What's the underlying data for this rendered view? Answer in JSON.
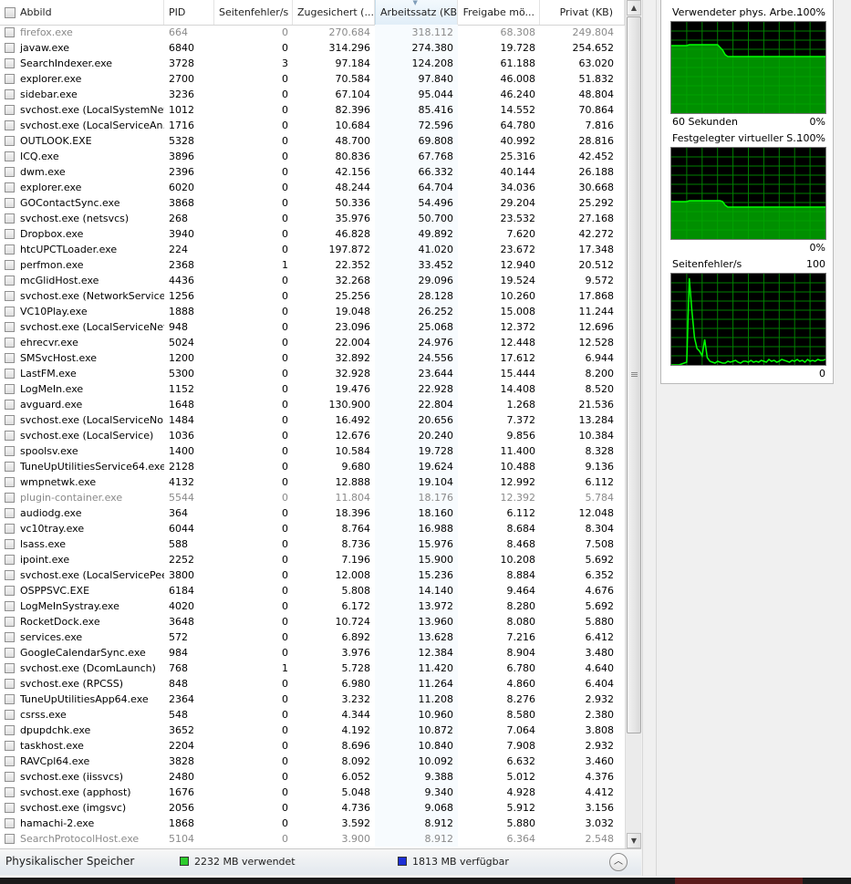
{
  "columns": {
    "name": "Abbild",
    "pid": "PID",
    "page_faults": "Seitenfehler/s",
    "commit": "Zugesichert (...",
    "working_set": "Arbeitssatz (KB)",
    "shareable": "Freigabe mö...",
    "private": "Privat (KB)"
  },
  "processes": [
    {
      "name": "firefox.exe",
      "pid": "664",
      "pf": "0",
      "commit": "270.684",
      "ws": "318.112",
      "share": "68.308",
      "priv": "249.804",
      "dim": true
    },
    {
      "name": "javaw.exe",
      "pid": "6840",
      "pf": "0",
      "commit": "314.296",
      "ws": "274.380",
      "share": "19.728",
      "priv": "254.652"
    },
    {
      "name": "SearchIndexer.exe",
      "pid": "3728",
      "pf": "3",
      "commit": "97.184",
      "ws": "124.208",
      "share": "61.188",
      "priv": "63.020"
    },
    {
      "name": "explorer.exe",
      "pid": "2700",
      "pf": "0",
      "commit": "70.584",
      "ws": "97.840",
      "share": "46.008",
      "priv": "51.832"
    },
    {
      "name": "sidebar.exe",
      "pid": "3236",
      "pf": "0",
      "commit": "67.104",
      "ws": "95.044",
      "share": "46.240",
      "priv": "48.804"
    },
    {
      "name": "svchost.exe (LocalSystemNet...",
      "pid": "1012",
      "pf": "0",
      "commit": "82.396",
      "ws": "85.416",
      "share": "14.552",
      "priv": "70.864"
    },
    {
      "name": "svchost.exe (LocalServiceAn...",
      "pid": "1716",
      "pf": "0",
      "commit": "10.684",
      "ws": "72.596",
      "share": "64.780",
      "priv": "7.816"
    },
    {
      "name": "OUTLOOK.EXE",
      "pid": "5328",
      "pf": "0",
      "commit": "48.700",
      "ws": "69.808",
      "share": "40.992",
      "priv": "28.816"
    },
    {
      "name": "ICQ.exe",
      "pid": "3896",
      "pf": "0",
      "commit": "80.836",
      "ws": "67.768",
      "share": "25.316",
      "priv": "42.452"
    },
    {
      "name": "dwm.exe",
      "pid": "2396",
      "pf": "0",
      "commit": "42.156",
      "ws": "66.332",
      "share": "40.144",
      "priv": "26.188"
    },
    {
      "name": "explorer.exe",
      "pid": "6020",
      "pf": "0",
      "commit": "48.244",
      "ws": "64.704",
      "share": "34.036",
      "priv": "30.668"
    },
    {
      "name": "GOContactSync.exe",
      "pid": "3868",
      "pf": "0",
      "commit": "50.336",
      "ws": "54.496",
      "share": "29.204",
      "priv": "25.292"
    },
    {
      "name": "svchost.exe (netsvcs)",
      "pid": "268",
      "pf": "0",
      "commit": "35.976",
      "ws": "50.700",
      "share": "23.532",
      "priv": "27.168"
    },
    {
      "name": "Dropbox.exe",
      "pid": "3940",
      "pf": "0",
      "commit": "46.828",
      "ws": "49.892",
      "share": "7.620",
      "priv": "42.272"
    },
    {
      "name": "htcUPCTLoader.exe",
      "pid": "224",
      "pf": "0",
      "commit": "197.872",
      "ws": "41.020",
      "share": "23.672",
      "priv": "17.348"
    },
    {
      "name": "perfmon.exe",
      "pid": "2368",
      "pf": "1",
      "commit": "22.352",
      "ws": "33.452",
      "share": "12.940",
      "priv": "20.512"
    },
    {
      "name": "mcGlidHost.exe",
      "pid": "4436",
      "pf": "0",
      "commit": "32.268",
      "ws": "29.096",
      "share": "19.524",
      "priv": "9.572"
    },
    {
      "name": "svchost.exe (NetworkService)",
      "pid": "1256",
      "pf": "0",
      "commit": "25.256",
      "ws": "28.128",
      "share": "10.260",
      "priv": "17.868"
    },
    {
      "name": "VC10Play.exe",
      "pid": "1888",
      "pf": "0",
      "commit": "19.048",
      "ws": "26.252",
      "share": "15.008",
      "priv": "11.244"
    },
    {
      "name": "svchost.exe (LocalServiceNet...",
      "pid": "948",
      "pf": "0",
      "commit": "23.096",
      "ws": "25.068",
      "share": "12.372",
      "priv": "12.696"
    },
    {
      "name": "ehrecvr.exe",
      "pid": "5024",
      "pf": "0",
      "commit": "22.004",
      "ws": "24.976",
      "share": "12.448",
      "priv": "12.528"
    },
    {
      "name": "SMSvcHost.exe",
      "pid": "1200",
      "pf": "0",
      "commit": "32.892",
      "ws": "24.556",
      "share": "17.612",
      "priv": "6.944"
    },
    {
      "name": "LastFM.exe",
      "pid": "5300",
      "pf": "0",
      "commit": "32.928",
      "ws": "23.644",
      "share": "15.444",
      "priv": "8.200"
    },
    {
      "name": "LogMeIn.exe",
      "pid": "1152",
      "pf": "0",
      "commit": "19.476",
      "ws": "22.928",
      "share": "14.408",
      "priv": "8.520"
    },
    {
      "name": "avguard.exe",
      "pid": "1648",
      "pf": "0",
      "commit": "130.900",
      "ws": "22.804",
      "share": "1.268",
      "priv": "21.536"
    },
    {
      "name": "svchost.exe (LocalServiceNo...",
      "pid": "1484",
      "pf": "0",
      "commit": "16.492",
      "ws": "20.656",
      "share": "7.372",
      "priv": "13.284"
    },
    {
      "name": "svchost.exe (LocalService)",
      "pid": "1036",
      "pf": "0",
      "commit": "12.676",
      "ws": "20.240",
      "share": "9.856",
      "priv": "10.384"
    },
    {
      "name": "spoolsv.exe",
      "pid": "1400",
      "pf": "0",
      "commit": "10.584",
      "ws": "19.728",
      "share": "11.400",
      "priv": "8.328"
    },
    {
      "name": "TuneUpUtilitiesService64.exe",
      "pid": "2128",
      "pf": "0",
      "commit": "9.680",
      "ws": "19.624",
      "share": "10.488",
      "priv": "9.136"
    },
    {
      "name": "wmpnetwk.exe",
      "pid": "4132",
      "pf": "0",
      "commit": "12.888",
      "ws": "19.104",
      "share": "12.992",
      "priv": "6.112"
    },
    {
      "name": "plugin-container.exe",
      "pid": "5544",
      "pf": "0",
      "commit": "11.804",
      "ws": "18.176",
      "share": "12.392",
      "priv": "5.784",
      "dim": true
    },
    {
      "name": "audiodg.exe",
      "pid": "364",
      "pf": "0",
      "commit": "18.396",
      "ws": "18.160",
      "share": "6.112",
      "priv": "12.048"
    },
    {
      "name": "vc10tray.exe",
      "pid": "6044",
      "pf": "0",
      "commit": "8.764",
      "ws": "16.988",
      "share": "8.684",
      "priv": "8.304"
    },
    {
      "name": "lsass.exe",
      "pid": "588",
      "pf": "0",
      "commit": "8.736",
      "ws": "15.976",
      "share": "8.468",
      "priv": "7.508"
    },
    {
      "name": "ipoint.exe",
      "pid": "2252",
      "pf": "0",
      "commit": "7.196",
      "ws": "15.900",
      "share": "10.208",
      "priv": "5.692"
    },
    {
      "name": "svchost.exe (LocalServicePee...",
      "pid": "3800",
      "pf": "0",
      "commit": "12.008",
      "ws": "15.236",
      "share": "8.884",
      "priv": "6.352"
    },
    {
      "name": "OSPPSVC.EXE",
      "pid": "6184",
      "pf": "0",
      "commit": "5.808",
      "ws": "14.140",
      "share": "9.464",
      "priv": "4.676"
    },
    {
      "name": "LogMeInSystray.exe",
      "pid": "4020",
      "pf": "0",
      "commit": "6.172",
      "ws": "13.972",
      "share": "8.280",
      "priv": "5.692"
    },
    {
      "name": "RocketDock.exe",
      "pid": "3648",
      "pf": "0",
      "commit": "10.724",
      "ws": "13.960",
      "share": "8.080",
      "priv": "5.880"
    },
    {
      "name": "services.exe",
      "pid": "572",
      "pf": "0",
      "commit": "6.892",
      "ws": "13.628",
      "share": "7.216",
      "priv": "6.412"
    },
    {
      "name": "GoogleCalendarSync.exe",
      "pid": "984",
      "pf": "0",
      "commit": "3.976",
      "ws": "12.384",
      "share": "8.904",
      "priv": "3.480"
    },
    {
      "name": "svchost.exe (DcomLaunch)",
      "pid": "768",
      "pf": "1",
      "commit": "5.728",
      "ws": "11.420",
      "share": "6.780",
      "priv": "4.640"
    },
    {
      "name": "svchost.exe (RPCSS)",
      "pid": "848",
      "pf": "0",
      "commit": "6.980",
      "ws": "11.264",
      "share": "4.860",
      "priv": "6.404"
    },
    {
      "name": "TuneUpUtilitiesApp64.exe",
      "pid": "2364",
      "pf": "0",
      "commit": "3.232",
      "ws": "11.208",
      "share": "8.276",
      "priv": "2.932"
    },
    {
      "name": "csrss.exe",
      "pid": "548",
      "pf": "0",
      "commit": "4.344",
      "ws": "10.960",
      "share": "8.580",
      "priv": "2.380"
    },
    {
      "name": "dpupdchk.exe",
      "pid": "3652",
      "pf": "0",
      "commit": "4.192",
      "ws": "10.872",
      "share": "7.064",
      "priv": "3.808"
    },
    {
      "name": "taskhost.exe",
      "pid": "2204",
      "pf": "0",
      "commit": "8.696",
      "ws": "10.840",
      "share": "7.908",
      "priv": "2.932"
    },
    {
      "name": "RAVCpl64.exe",
      "pid": "3828",
      "pf": "0",
      "commit": "8.092",
      "ws": "10.092",
      "share": "6.632",
      "priv": "3.460"
    },
    {
      "name": "svchost.exe (iissvcs)",
      "pid": "2480",
      "pf": "0",
      "commit": "6.052",
      "ws": "9.388",
      "share": "5.012",
      "priv": "4.376"
    },
    {
      "name": "svchost.exe (apphost)",
      "pid": "1676",
      "pf": "0",
      "commit": "5.048",
      "ws": "9.340",
      "share": "4.928",
      "priv": "4.412"
    },
    {
      "name": "svchost.exe (imgsvc)",
      "pid": "2056",
      "pf": "0",
      "commit": "4.736",
      "ws": "9.068",
      "share": "5.912",
      "priv": "3.156"
    },
    {
      "name": "hamachi-2.exe",
      "pid": "1868",
      "pf": "0",
      "commit": "3.592",
      "ws": "8.912",
      "share": "5.880",
      "priv": "3.032"
    },
    {
      "name": "SearchProtocolHost.exe",
      "pid": "5104",
      "pf": "0",
      "commit": "3.900",
      "ws": "8.912",
      "share": "6.364",
      "priv": "2.548",
      "dim": true
    }
  ],
  "status": {
    "title": "Physikalischer Speicher",
    "used": "2232 MB verwendet",
    "available": "1813 MB verfügbar",
    "used_color": "#2ecc2e",
    "available_color": "#1d2fd6"
  },
  "graphs": {
    "phys": {
      "title": "Verwendeter phys. Arbe...",
      "max": "100%",
      "time": "60 Sekunden",
      "min": "0%",
      "values": [
        74,
        74,
        74,
        74,
        74,
        74,
        74,
        75,
        75,
        75,
        75,
        75,
        75,
        75,
        75,
        75,
        75,
        75,
        75,
        72,
        69,
        64,
        62,
        62,
        62,
        62,
        62,
        62,
        62,
        62,
        62,
        62,
        62,
        62,
        62,
        62,
        62,
        62,
        62,
        62,
        62,
        62,
        62,
        62,
        62,
        62,
        62,
        62,
        62,
        62,
        62,
        62,
        62,
        62,
        62,
        62,
        62,
        62,
        62,
        62,
        62
      ]
    },
    "virt": {
      "title": "Festgelegter virtueller S...",
      "max": "100%",
      "min": "0%",
      "values": [
        41,
        41,
        41,
        41,
        41,
        41,
        41,
        42,
        42,
        42,
        42,
        42,
        42,
        42,
        42,
        42,
        42,
        42,
        42,
        42,
        41,
        37,
        35,
        35,
        35,
        35,
        35,
        35,
        35,
        35,
        35,
        35,
        35,
        35,
        35,
        35,
        35,
        35,
        35,
        35,
        35,
        35,
        35,
        35,
        35,
        35,
        35,
        35,
        35,
        35,
        35,
        35,
        35,
        35,
        35,
        35,
        35,
        35,
        35,
        35,
        35
      ]
    },
    "faults": {
      "title": "Seitenfehler/s",
      "max": "100",
      "min": "0",
      "values": [
        0,
        0,
        0,
        0,
        1,
        2,
        3,
        95,
        60,
        30,
        18,
        15,
        10,
        28,
        8,
        4,
        3,
        2,
        4,
        3,
        2,
        2,
        4,
        3,
        4,
        5,
        3,
        2,
        4,
        4,
        3,
        5,
        3,
        4,
        3,
        5,
        4,
        3,
        6,
        4,
        5,
        3,
        4,
        6,
        5,
        4,
        3,
        5,
        4,
        6,
        4,
        5,
        3,
        6,
        4,
        5,
        4,
        6,
        5,
        5,
        6
      ]
    },
    "line_color": "#00ff00",
    "fill_color": "#00a800",
    "grid_color": "#008000"
  }
}
